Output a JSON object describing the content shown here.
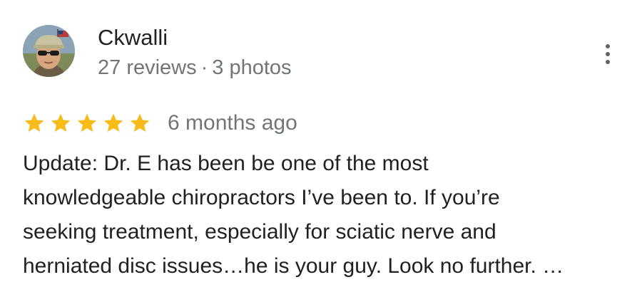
{
  "reviewer": {
    "name": "Ckwalli",
    "reviews_count": "27 reviews",
    "separator": "·",
    "photos_count": "3 photos"
  },
  "rating": {
    "stars": 5,
    "max_stars": 5,
    "star_color": "#f8bb18",
    "date": "6 months ago"
  },
  "review": {
    "lines": [
      "Update: Dr. E has been be one of the most",
      "knowledgeable chiropractors I’ve been to. If you’re",
      "seeking treatment, especially for sciatic nerve and",
      "herniated disc issues…he is your guy. Look no further. …"
    ]
  },
  "icons": {
    "menu": "more-vert-icon",
    "star": "star-icon",
    "avatar": "avatar-photo"
  },
  "colors": {
    "primary_text": "#202124",
    "secondary_text": "#70757a",
    "menu_dots": "#5f6368"
  }
}
